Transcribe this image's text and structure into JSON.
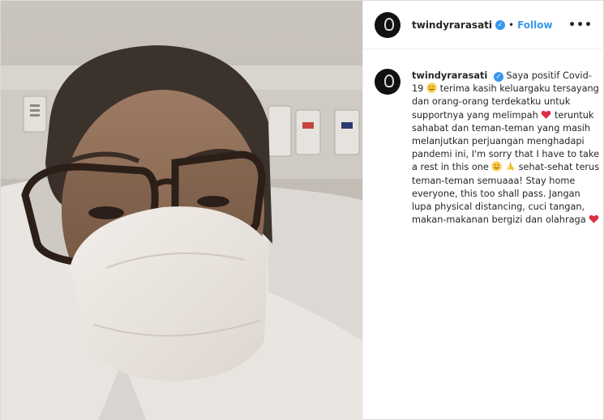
{
  "post": {
    "username": "twindyrarasati",
    "separator": "•",
    "follow_label": "Follow",
    "more_label": "•••",
    "verified_mark": "✓",
    "caption_parts": [
      "Saya positif Covid-19 ",
      " terima kasih keluargaku tersayang dan orang-orang terdekatku untuk supportnya yang melimpah ",
      " teruntuk sahabat dan teman-teman yang masih melanjutkan perjuangan menghadapi pandemi ini, I'm sorry that I have to take a rest in this one ",
      " sehat-sehat terus teman-teman semuaaa! Stay home everyone, this too shall pass. Jangan lupa physical distancing, cuci tangan, makan-makanan bergizi dan olahraga "
    ],
    "emojis": [
      "smiling-face-emoji",
      "red-heart-emoji",
      "smiling-face-emoji",
      "folded-hands-emoji",
      "red-heart-emoji"
    ]
  },
  "colors": {
    "link_blue": "#3897f0",
    "text": "#262626",
    "border": "#dbdbdb",
    "heart_red": "#e0245e"
  }
}
